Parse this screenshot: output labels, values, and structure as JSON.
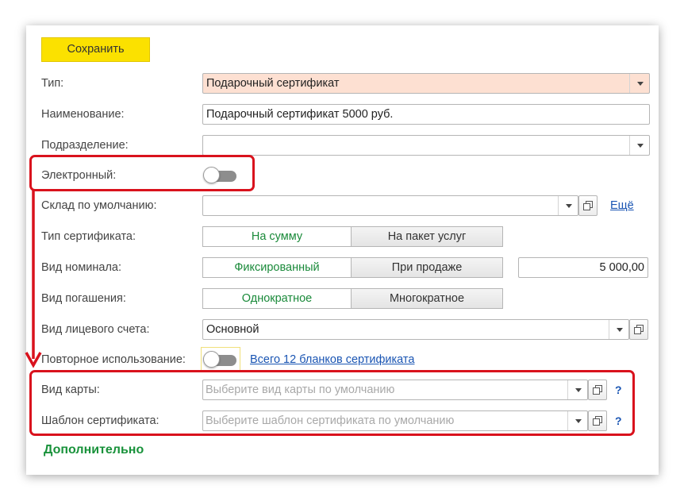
{
  "toolbar": {
    "save_label": "Сохранить"
  },
  "fields": {
    "type": {
      "label": "Тип:",
      "value": "Подарочный сертификат"
    },
    "name": {
      "label": "Наименование:",
      "value": "Подарочный сертификат 5000 руб."
    },
    "division": {
      "label": "Подразделение:",
      "value": ""
    },
    "electronic": {
      "label": "Электронный:",
      "on": false
    },
    "warehouse": {
      "label": "Склад по умолчанию:",
      "value": "",
      "more_label": "Ещё"
    },
    "cert_type": {
      "label": "Тип сертификата:",
      "options": [
        "На сумму",
        "На пакет услуг"
      ],
      "selected": "На сумму"
    },
    "nominal": {
      "label": "Вид номинала:",
      "options": [
        "Фиксированный",
        "При продаже"
      ],
      "selected": "Фиксированный",
      "amount": "5 000,00"
    },
    "repayment": {
      "label": "Вид погашения:",
      "options": [
        "Однократное",
        "Многократное"
      ],
      "selected": "Однократное"
    },
    "account": {
      "label": "Вид лицевого счета:",
      "value": "Основной"
    },
    "reuse": {
      "label": "Повторное использование:",
      "on": false,
      "link": "Всего 12 бланков сертификата"
    },
    "card_type": {
      "label": "Вид карты:",
      "placeholder": "Выберите вид карты по умолчанию",
      "help": "?"
    },
    "template": {
      "label": "Шаблон сертификата:",
      "placeholder": "Выберите шаблон сертификата по умолчанию",
      "help": "?"
    }
  },
  "additional_label": "Дополнительно",
  "colors": {
    "save_button": "#fbe100",
    "highlight": "#d9121d",
    "active_segment": "#1a8a3a",
    "link": "#1a55b3",
    "type_field_bg": "#fde0d2"
  }
}
